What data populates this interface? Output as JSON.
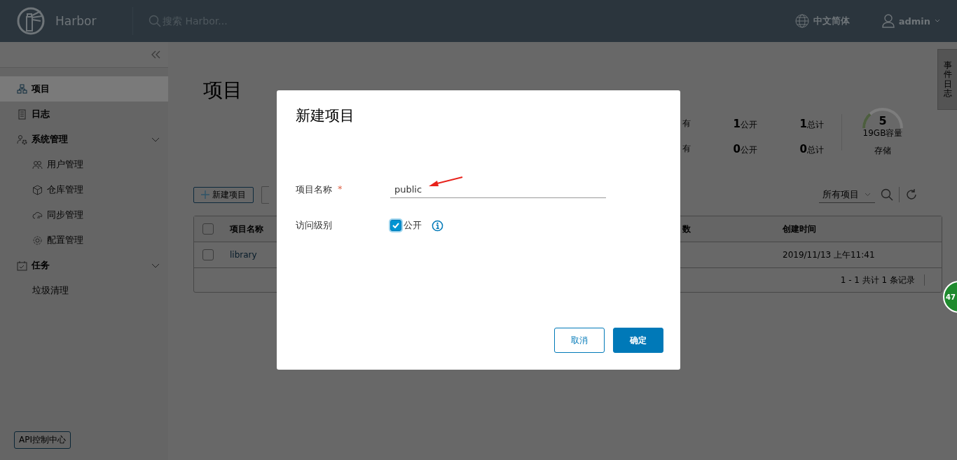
{
  "header": {
    "brand": "Harbor",
    "search": {
      "placeholder": "搜索 Harbor..."
    },
    "language": "中文简体",
    "user": "admin"
  },
  "sidebar": {
    "items": [
      {
        "label": "项目",
        "kind": "projects",
        "selected": true
      },
      {
        "label": "日志",
        "kind": "log",
        "selected": false
      },
      {
        "label": "系统管理",
        "kind": "admin",
        "selected": false,
        "expanded": true,
        "children": [
          {
            "label": "用户管理",
            "kind": "users",
            "selected": false
          },
          {
            "label": "仓库管理",
            "kind": "registry",
            "selected": false
          },
          {
            "label": "同步管理",
            "kind": "replication",
            "selected": false
          },
          {
            "label": "配置管理",
            "kind": "config",
            "selected": false
          }
        ]
      },
      {
        "label": "任务",
        "kind": "tasks",
        "selected": false,
        "expanded": true,
        "children": [
          {
            "label": "垃圾清理",
            "kind": "none",
            "selected": false
          }
        ]
      }
    ],
    "api_button": "API控制中心"
  },
  "page": {
    "title": "项目",
    "stats": {
      "rows": [
        [
          {
            "label": "有"
          },
          {
            "count": "1",
            "label": "公开"
          },
          {
            "count": "1",
            "label": "总计"
          }
        ],
        [
          {
            "label": "有"
          },
          {
            "count": "0",
            "label": "公开"
          },
          {
            "count": "0",
            "label": "总计"
          }
        ]
      ],
      "storage": {
        "value": "5",
        "capacity": "19GB容量",
        "label": "存储"
      }
    },
    "toolbar": {
      "new_button": "新建项目",
      "filter": "所有项目"
    },
    "table": {
      "all_checked": false,
      "columns": [
        "项目名称",
        "数",
        "创建时间"
      ],
      "rows": [
        {
          "checked": false,
          "project_name": "library",
          "created_time": "2019/11/13 上午11:41"
        }
      ],
      "footer": "1 - 1 共计 1 条记录"
    }
  },
  "event_log_tab": "事件日志",
  "floating_badge": "47",
  "dialog": {
    "title": "新建项目",
    "fields": [
      {
        "kind": "text",
        "label": "项目名称",
        "required_mark": "*",
        "value": "public"
      },
      {
        "kind": "checkbox",
        "label": "访问级别",
        "checked": true,
        "option": "公开"
      }
    ],
    "buttons": [
      {
        "label": "取消",
        "kind": "secondary"
      },
      {
        "label": "确定",
        "kind": "primary"
      }
    ]
  }
}
